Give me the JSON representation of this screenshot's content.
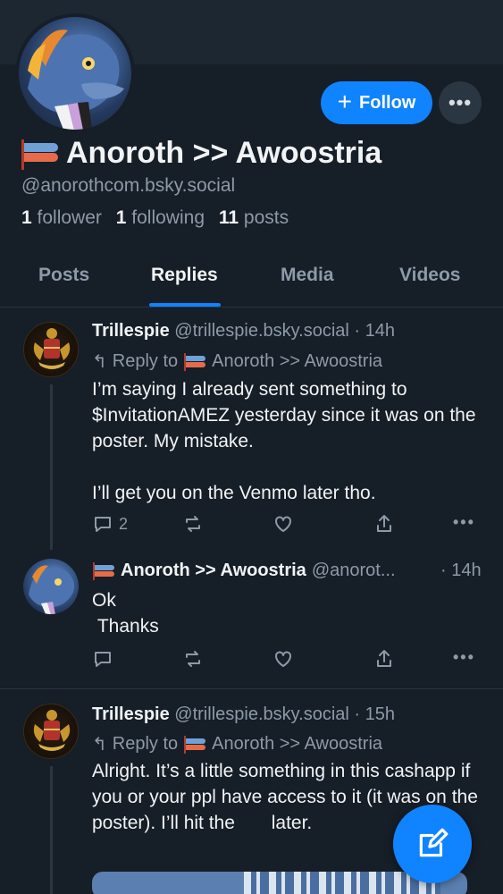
{
  "profile": {
    "display_name": "Anoroth >> Awoostria",
    "handle": "@anorothcom.bsky.social",
    "followers_count": "1",
    "followers_label": "follower",
    "following_count": "1",
    "following_label": "following",
    "posts_count": "11",
    "posts_label": "posts",
    "follow_label": "Follow"
  },
  "tabs": [
    {
      "label": "Posts"
    },
    {
      "label": "Replies"
    },
    {
      "label": "Media"
    },
    {
      "label": "Videos"
    }
  ],
  "active_tab": "Replies",
  "posts": [
    {
      "author": "Trillespie",
      "handle": "@trillespie.bsky.social",
      "time": "· 14h",
      "reply_prefix": "Reply to",
      "reply_to": "Anoroth >> Awoostria",
      "text": "I’m saying I already sent something to $InvitationAMEZ yesterday since it was on the poster. My mistake.\n\nI’ll get you on the Venmo later tho.",
      "reply_count": "2"
    },
    {
      "author": "Anoroth >> Awoostria",
      "handle": "@anorot...",
      "time": "· 14h",
      "text": "Ok\n Thanks",
      "reply_count": ""
    },
    {
      "author": "Trillespie",
      "handle": "@trillespie.bsky.social",
      "time": "· 15h",
      "reply_prefix": "Reply to",
      "reply_to": "Anoroth >> Awoostria",
      "text": "Alright. It’s a little something in this cashapp if you or your ppl have access to it (it was on the poster). I’ll hit the       later."
    }
  ],
  "colors": {
    "background": "#161e27",
    "accent": "#1083fe",
    "muted": "#8d9aa8"
  },
  "icons": [
    "plus-icon",
    "ellipsis-icon",
    "reply-arrow-icon",
    "comment-icon",
    "repost-icon",
    "heart-icon",
    "share-icon",
    "compose-icon"
  ]
}
